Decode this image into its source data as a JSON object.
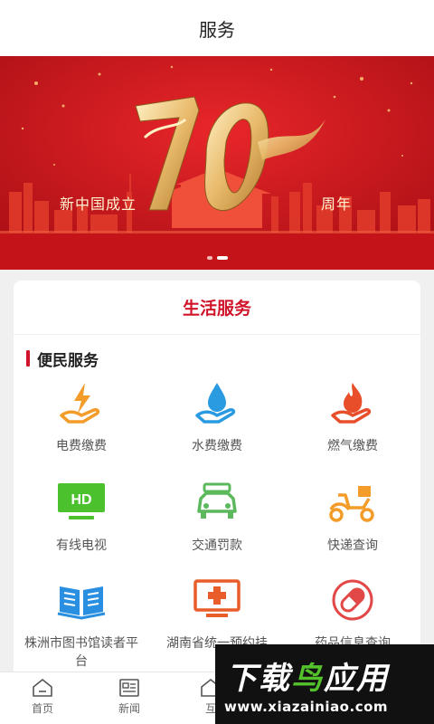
{
  "header": {
    "title": "服务"
  },
  "banner": {
    "text_left": "新中国成立",
    "text_right": "周年",
    "big_number": "70",
    "dots_total": 2,
    "dot_active_index": 1
  },
  "card": {
    "title": "生活服务",
    "section_title": "便民服务",
    "items": [
      {
        "label": "电费缴费",
        "icon": "electricity-icon",
        "color": "#f39c2a"
      },
      {
        "label": "水费缴费",
        "icon": "water-icon",
        "color": "#2a9be0"
      },
      {
        "label": "燃气缴费",
        "icon": "gas-flame-icon",
        "color": "#e94e2a"
      },
      {
        "label": "有线电视",
        "icon": "tv-hd-icon",
        "color": "#4cc12e"
      },
      {
        "label": "交通罚款",
        "icon": "car-icon",
        "color": "#5cb85c"
      },
      {
        "label": "快递查询",
        "icon": "scooter-icon",
        "color": "#f39c2a"
      },
      {
        "label": "株洲市图书馆读者平台",
        "icon": "book-icon",
        "color": "#2a8fe0"
      },
      {
        "label": "湖南省统一预约挂",
        "icon": "medical-icon",
        "color": "#e85d2a"
      },
      {
        "label": "药品信息查询",
        "icon": "pill-icon",
        "color": "#e24848"
      }
    ]
  },
  "tabbar": {
    "tabs": [
      {
        "label": "首页",
        "icon": "home-icon"
      },
      {
        "label": "新闻",
        "icon": "news-icon"
      },
      {
        "label": "互",
        "icon": "interact-icon"
      }
    ]
  },
  "watermark": {
    "title_part1": "下载",
    "title_part2": "鸟",
    "title_part3": "应用",
    "url": "www.xiazainiao.com"
  },
  "colors": {
    "accent": "#d0142a",
    "banner_red": "#c8161d"
  }
}
